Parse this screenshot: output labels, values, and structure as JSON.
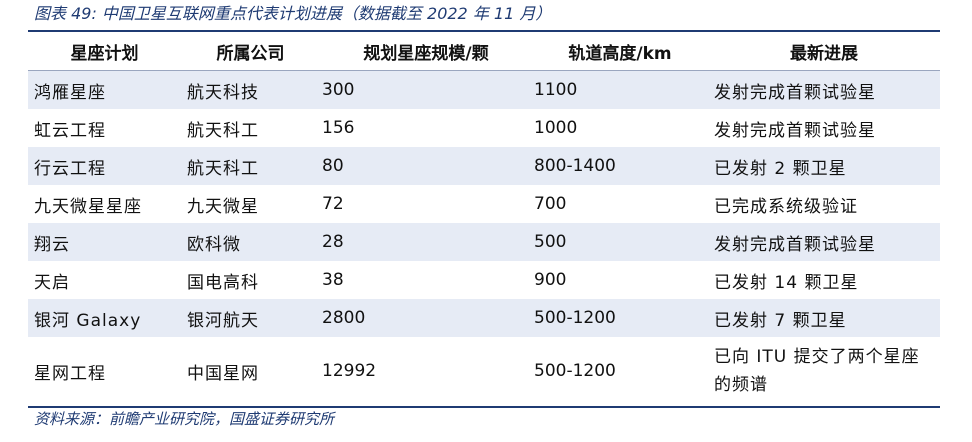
{
  "caption": "图表 49: 中国卫星互联网重点代表计划进展（数据截至 2022 年 11 月）",
  "table": {
    "headers": [
      "星座计划",
      "所属公司",
      "规划星座规模/颗",
      "轨道高度/km",
      "最新进展"
    ],
    "rows": [
      [
        "鸿雁星座",
        "航天科技",
        "300",
        "1100",
        "发射完成首颗试验星"
      ],
      [
        "虹云工程",
        "航天科工",
        "156",
        "1000",
        "发射完成首颗试验星"
      ],
      [
        "行云工程",
        "航天科工",
        "80",
        "800-1400",
        "已发射 2 颗卫星"
      ],
      [
        "九天微星星座",
        "九天微星",
        "72",
        "700",
        "已完成系统级验证"
      ],
      [
        "翔云",
        "欧科微",
        "28",
        "500",
        "发射完成首颗试验星"
      ],
      [
        "天启",
        "国电高科",
        "38",
        "900",
        "已发射 14 颗卫星"
      ],
      [
        "银河 Galaxy",
        "银河航天",
        "2800",
        "500-1200",
        "已发射 7 颗卫星"
      ],
      [
        "星网工程",
        "中国星网",
        "12992",
        "500-1200",
        "已向 ITU 提交了两个星座的频谱"
      ]
    ]
  },
  "source": "资料来源：前瞻产业研究院，国盛证券研究所",
  "colors": {
    "accent": "#1f3b73",
    "row_shade": "#e6ebf5"
  }
}
